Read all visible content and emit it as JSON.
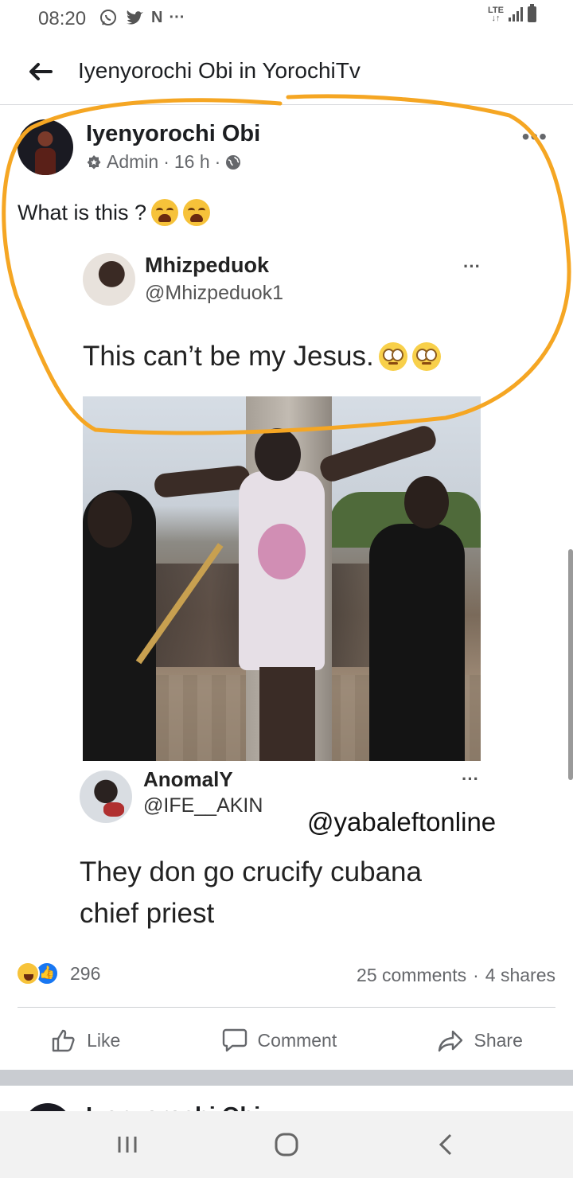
{
  "status_bar": {
    "time": "08:20",
    "network": "LTE",
    "icons": [
      "whatsapp-icon",
      "twitter-icon",
      "n-app-icon",
      "more-notifications-icon",
      "signal-icon",
      "battery-icon"
    ]
  },
  "header": {
    "title": "Iyenyorochi Obi in YorochiTv"
  },
  "post": {
    "author": "Iyenyorochi Obi",
    "role": "Admin",
    "time": "16 h",
    "caption": "What is this ?",
    "reactions_count": "296",
    "comments": "25 comments",
    "shares": "4 shares",
    "actions": {
      "like": "Like",
      "comment": "Comment",
      "share": "Share"
    }
  },
  "tweet1": {
    "name": "Mhizpeduok",
    "handle": "@Mhizpeduok1",
    "text": "This can’t be my Jesus."
  },
  "tweet2": {
    "name": "AnomalY",
    "handle": "@IFE__AKIN",
    "watermark": "@yabaleftonline",
    "text": "They don go crucify cubana chief priest"
  },
  "next_post": {
    "author": "Iyenyorochi Obi"
  },
  "colors": {
    "annotation": "#f5a623",
    "facebook_blue": "#1877f2",
    "meta_gray": "#65676b"
  }
}
